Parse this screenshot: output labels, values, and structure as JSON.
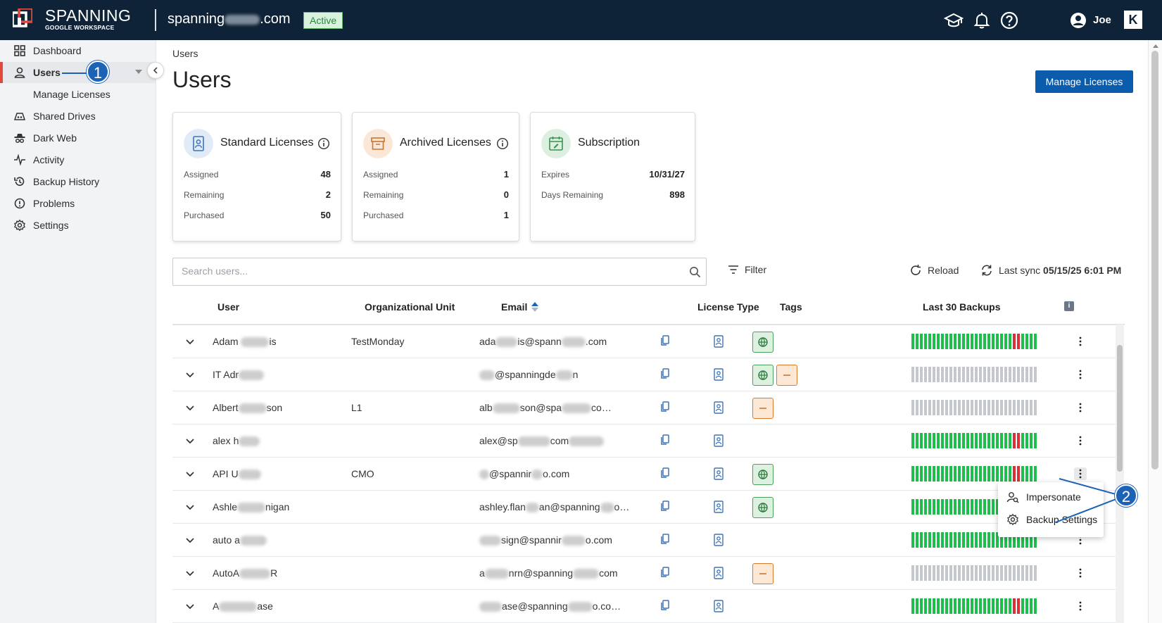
{
  "brand": {
    "name": "SPANNING",
    "sub": "GOOGLE WORKSPACE"
  },
  "topbar": {
    "domain_prefix": "spanning",
    "domain_suffix": ".com",
    "status": "Active",
    "user": "Joe",
    "k_logo": "K"
  },
  "icons": {
    "logo": "spanning-logo-icon",
    "training": "graduation-cap-icon",
    "notifications": "bell-icon",
    "help": "help-icon",
    "user": "account-icon",
    "search": "search-icon",
    "filter": "filter-icon",
    "reload": "reload-icon",
    "sync": "sync-icon",
    "copy": "copy-icon",
    "license": "license-badge-icon",
    "expand": "chevron-down-icon",
    "more": "kebab-icon"
  },
  "sidebar": {
    "items": [
      {
        "label": "Dashboard",
        "icon": "grid-icon"
      },
      {
        "label": "Users",
        "icon": "user-icon"
      },
      {
        "label": "Manage Licenses",
        "icon": ""
      },
      {
        "label": "Shared Drives",
        "icon": "shared-drive-icon"
      },
      {
        "label": "Dark Web",
        "icon": "spy-icon"
      },
      {
        "label": "Activity",
        "icon": "activity-icon"
      },
      {
        "label": "Backup History",
        "icon": "history-icon"
      },
      {
        "label": "Problems",
        "icon": "alert-icon"
      },
      {
        "label": "Settings",
        "icon": "gear-icon"
      }
    ]
  },
  "callouts": [
    "1",
    "2"
  ],
  "breadcrumb": "Users",
  "page_title": "Users",
  "manage_licenses_button": "Manage Licenses",
  "cards": {
    "standard": {
      "title": "Standard Licenses",
      "rows": [
        {
          "label": "Assigned",
          "value": "48"
        },
        {
          "label": "Remaining",
          "value": "2"
        },
        {
          "label": "Purchased",
          "value": "50"
        }
      ]
    },
    "archived": {
      "title": "Archived Licenses",
      "rows": [
        {
          "label": "Assigned",
          "value": "1"
        },
        {
          "label": "Remaining",
          "value": "0"
        },
        {
          "label": "Purchased",
          "value": "1"
        }
      ]
    },
    "subscription": {
      "title": "Subscription",
      "rows": [
        {
          "label": "Expires",
          "value": "10/31/27"
        },
        {
          "label": "Days Remaining",
          "value": "898"
        }
      ]
    }
  },
  "search": {
    "placeholder": "Search users...",
    "value": ""
  },
  "toolbar": {
    "filter": "Filter",
    "reload": "Reload",
    "last_sync_label": "Last sync",
    "last_sync_value": "05/15/25 6:01 PM"
  },
  "table": {
    "columns": [
      "User",
      "Organizational Unit",
      "Email",
      "License Type",
      "Tags",
      "Last 30 Backups"
    ],
    "info_chip": "i",
    "rows": [
      {
        "user": [
          "Adam ",
          "is"
        ],
        "ou": "TestMonday",
        "email": [
          "ada",
          "is@spann",
          ".com"
        ],
        "tags": [
          "green"
        ],
        "backups": "recent-fail",
        "kebab_open": false
      },
      {
        "user": [
          "IT Adr"
        ],
        "ou": "",
        "email": [
          "",
          "@spanningde",
          "n"
        ],
        "tags": [
          "green",
          "orange"
        ],
        "backups": "none",
        "kebab_open": false
      },
      {
        "user": [
          "Albert",
          "son"
        ],
        "ou": "L1",
        "email": [
          "alb",
          "son@spa",
          "co…"
        ],
        "tags": [
          "orange"
        ],
        "backups": "none",
        "kebab_open": false
      },
      {
        "user": [
          "alex h"
        ],
        "ou": "",
        "email": [
          "alex@sp",
          "com"
        ],
        "tags": [],
        "backups": "recent-fail",
        "kebab_open": false
      },
      {
        "user": [
          "API U"
        ],
        "ou": "CMO",
        "email": [
          "",
          "@spannir",
          "o.com"
        ],
        "tags": [
          "green"
        ],
        "backups": "recent-fail",
        "kebab_open": true
      },
      {
        "user": [
          "Ashle",
          "nigan"
        ],
        "ou": "",
        "email": [
          "ashley.flan",
          "an@spanning",
          "o…"
        ],
        "tags": [
          "green"
        ],
        "backups": "ok",
        "kebab_open": false
      },
      {
        "user": [
          "auto a"
        ],
        "ou": "",
        "email": [
          "",
          "sign@spannir",
          "o.com"
        ],
        "tags": [],
        "backups": "ok",
        "kebab_open": false
      },
      {
        "user": [
          "AutoA",
          "R"
        ],
        "ou": "",
        "email": [
          "a",
          "nrn@spanning",
          "com"
        ],
        "tags": [
          "orange"
        ],
        "backups": "none",
        "kebab_open": false
      },
      {
        "user": [
          "A",
          "ase"
        ],
        "ou": "",
        "email": [
          "",
          "ase@spanning",
          "o.co…"
        ],
        "tags": [],
        "backups": "recent-fail",
        "kebab_open": false
      }
    ]
  },
  "row_menu": {
    "items": [
      {
        "label": "Impersonate",
        "icon": "impersonate-icon"
      },
      {
        "label": "Backup Settings",
        "icon": "gear-icon"
      }
    ]
  },
  "colors": {
    "topbar": "#0f2338",
    "accent": "#0b5cad",
    "active_nav": "#e0483a",
    "backup_ok": "#1fbe4c",
    "backup_fail": "#d9303a",
    "backup_none": "#c4c7cc",
    "tag_green": "#4aa15a",
    "tag_orange": "#d97b2f",
    "callout": "#1d63b5"
  }
}
